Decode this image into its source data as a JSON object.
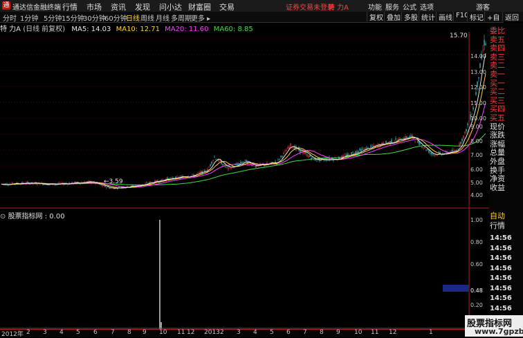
{
  "app": {
    "title": "通达信金融终端",
    "logo_text": "通"
  },
  "menu": [
    "行情",
    "市场",
    "资讯",
    "发现",
    "问小达",
    "财富圈",
    "交易"
  ],
  "status": "证券交易未登录",
  "stock_name": "特 力A",
  "right_tools": [
    "功能",
    "服务",
    "公式",
    "选项"
  ],
  "guest": "游客",
  "period_tabs": [
    "分时",
    "1分钟",
    "5分钟",
    "15分钟",
    "30分钟",
    "60分钟",
    "日线",
    "周线",
    "月线",
    "多周期",
    "更多 ▸"
  ],
  "active_period": "日线",
  "toolbar_buttons": [
    "复权",
    "叠加",
    "多股",
    "统计",
    "画线",
    "F10",
    "标记",
    "+自选",
    "返回"
  ],
  "info": {
    "name": "特 力A",
    "mode": "(日线 前复权)",
    "ma5": "MA5: 14.03",
    "ma10": "MA10: 12.71",
    "ma20": "MA20: 11.60",
    "ma60": "MA60: 8.85"
  },
  "colors": {
    "ma5": "#e8e8e8",
    "ma10": "#ffd23a",
    "ma20": "#ff40ff",
    "ma60": "#40e040",
    "up": "#ff3b3b",
    "down": "#40d0d0"
  },
  "price_labels": [
    "14.00",
    "13.00",
    "12.00",
    "11.00",
    "10.00",
    "9.00",
    "8.00",
    "7.00",
    "6.00",
    "5.00",
    "4.00"
  ],
  "high_marker": "15.70",
  "low_marker": "3.59",
  "indicator": {
    "title": "股票指标网 : 0.00",
    "labels": [
      "1.00",
      "0.80",
      "0.60",
      "0.48",
      "0.20"
    ]
  },
  "date_labels": [
    "2012年",
    "2",
    "3",
    "4",
    "5",
    "6",
    "7",
    "8",
    "9",
    "10",
    "11",
    "12",
    "2013",
    "2",
    "3",
    "4",
    "5",
    "6",
    "7",
    "8",
    "9",
    "10",
    "11",
    "12",
    "1"
  ],
  "right_panel": {
    "top": [
      "委比",
      "卖五",
      "卖四",
      "卖三",
      "卖二",
      "卖一",
      "买一",
      "买二",
      "买三",
      "买四",
      "买五",
      "现价",
      "涨跌",
      "涨幅",
      "总量",
      "外盘",
      "换手",
      "净资",
      "收益"
    ],
    "mid": [
      "自动",
      "行情"
    ],
    "times": [
      "14:56",
      "14:56",
      "14:56",
      "14:56",
      "14:56",
      "14:56",
      "14:56",
      "14:56",
      "14:56"
    ]
  },
  "watermark": {
    "line1": "股票指标网",
    "line2": "www.7gpzb.com"
  }
}
